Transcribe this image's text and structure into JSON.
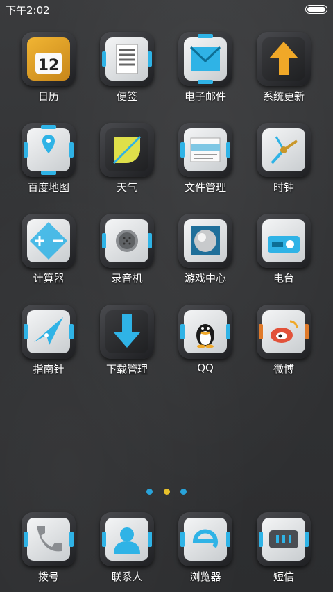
{
  "status_bar": {
    "time": "下午2:02"
  },
  "apps": [
    {
      "label": "日历",
      "icon": "calendar-icon"
    },
    {
      "label": "便签",
      "icon": "notes-icon"
    },
    {
      "label": "电子邮件",
      "icon": "email-icon"
    },
    {
      "label": "系统更新",
      "icon": "update-icon"
    },
    {
      "label": "百度地图",
      "icon": "map-icon"
    },
    {
      "label": "天气",
      "icon": "weather-icon"
    },
    {
      "label": "文件管理",
      "icon": "file-manager-icon"
    },
    {
      "label": "时钟",
      "icon": "clock-icon"
    },
    {
      "label": "计算器",
      "icon": "calculator-icon"
    },
    {
      "label": "录音机",
      "icon": "recorder-icon"
    },
    {
      "label": "游戏中心",
      "icon": "game-center-icon"
    },
    {
      "label": "电台",
      "icon": "radio-icon"
    },
    {
      "label": "指南针",
      "icon": "compass-icon"
    },
    {
      "label": "下载管理",
      "icon": "download-icon"
    },
    {
      "label": "QQ",
      "icon": "qq-icon"
    },
    {
      "label": "微博",
      "icon": "weibo-icon"
    }
  ],
  "page_indicator": {
    "count": 3,
    "active_index": 1
  },
  "dock": [
    {
      "label": "拨号",
      "icon": "phone-icon"
    },
    {
      "label": "联系人",
      "icon": "contacts-icon"
    },
    {
      "label": "浏览器",
      "icon": "browser-icon"
    },
    {
      "label": "短信",
      "icon": "messages-icon"
    }
  ],
  "colors": {
    "accent": "#2fb3e6",
    "active_dot": "#e8c12b",
    "orange": "#e07a2a"
  }
}
